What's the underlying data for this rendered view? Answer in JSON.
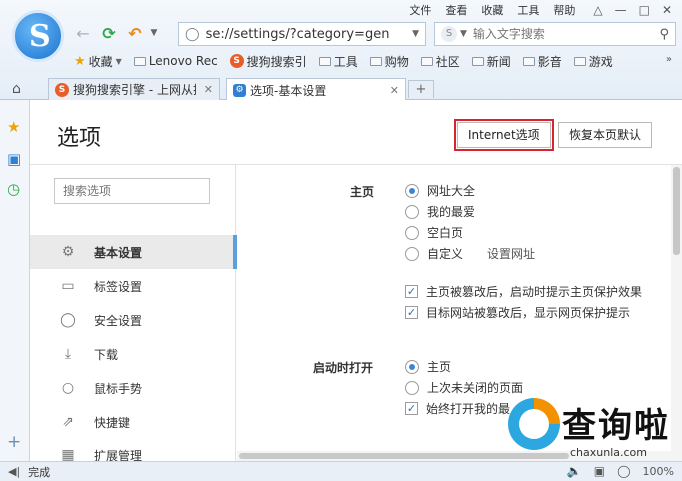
{
  "menu": {
    "items": [
      "文件",
      "查看",
      "收藏",
      "工具",
      "帮助"
    ]
  },
  "address": {
    "url": "se://settings/?category=gen"
  },
  "search": {
    "placeholder": "输入文字搜索"
  },
  "bookmarks": {
    "items": [
      "收藏",
      "Lenovo Rec",
      "搜狗搜索引",
      "工具",
      "购物",
      "社区",
      "新闻",
      "影音",
      "游戏"
    ]
  },
  "tabs": [
    {
      "label": "搜狗搜索引擎 - 上网从搜"
    },
    {
      "label": "选项-基本设置"
    }
  ],
  "page": {
    "title": "选项",
    "internet_button": "Internet选项",
    "restore_button": "恢复本页默认",
    "search_placeholder": "搜索选项"
  },
  "sidebar": {
    "items": [
      {
        "label": "基本设置",
        "icon": "gear-icon",
        "active": true
      },
      {
        "label": "标签设置",
        "icon": "tab-icon"
      },
      {
        "label": "安全设置",
        "icon": "shield-icon"
      },
      {
        "label": "下载",
        "icon": "download-icon"
      },
      {
        "label": "鼠标手势",
        "icon": "mouse-icon"
      },
      {
        "label": "快捷键",
        "icon": "shortcut-icon"
      },
      {
        "label": "扩展管理",
        "icon": "extension-icon"
      }
    ]
  },
  "homepage": {
    "label": "主页",
    "options": [
      "网址大全",
      "我的最爱",
      "空白页",
      "自定义"
    ],
    "selected": "网址大全",
    "custom_link": "设置网址",
    "checks": [
      "主页被篡改后，启动时提示主页保护效果",
      "目标网站被篡改后，显示网页保护提示"
    ]
  },
  "startup": {
    "label": "启动时打开",
    "options": [
      "主页",
      "上次未关闭的页面"
    ],
    "selected": "主页",
    "checks": [
      "始终打开我的最"
    ]
  },
  "status": {
    "text": "完成",
    "zoom": "100%"
  },
  "watermark": {
    "text": "查询啦",
    "url": "chaxunla.com"
  }
}
